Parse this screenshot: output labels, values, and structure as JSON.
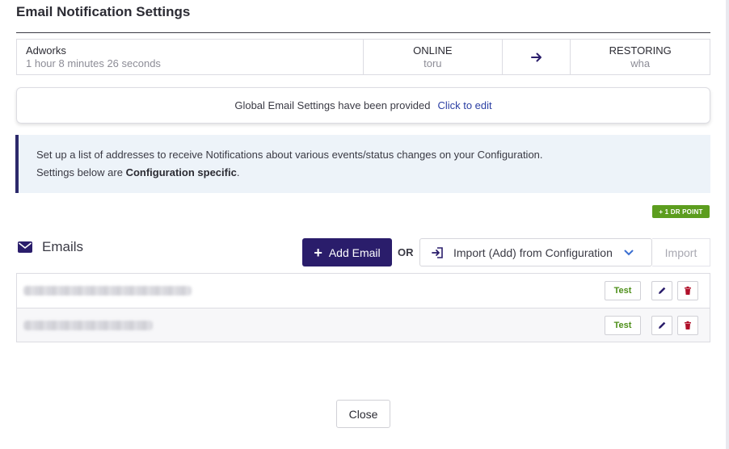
{
  "title": "Email Notification Settings",
  "status": {
    "name": "Adworks",
    "duration": "1 hour 8 minutes 26 seconds",
    "source": {
      "state": "ONLINE",
      "host": "toru"
    },
    "target": {
      "state": "RESTORING",
      "host": "wha"
    },
    "arrow_icon": "arrow-right-icon"
  },
  "global": {
    "message": "Global Email Settings have been provided",
    "edit_link": "Click to edit"
  },
  "info": {
    "line1": "Set up a list of addresses to receive Notifications about various events/status changes on your Configuration.",
    "line2_prefix": "Settings below are ",
    "line2_bold": "Configuration specific",
    "line2_suffix": "."
  },
  "badge": "+ 1 DR POINT",
  "emails": {
    "heading": "Emails",
    "add_label": "Add Email",
    "or_label": "OR",
    "import_select_value": "Import (Add) from Configuration",
    "import_button": "Import",
    "rows": [
      {
        "test_label": "Test"
      },
      {
        "test_label": "Test"
      }
    ]
  },
  "footer": {
    "close_label": "Close"
  },
  "colors": {
    "accent": "#2a1d6b",
    "link": "#2b3fa3",
    "success": "#5c9d1e",
    "danger": "#b0102a"
  }
}
